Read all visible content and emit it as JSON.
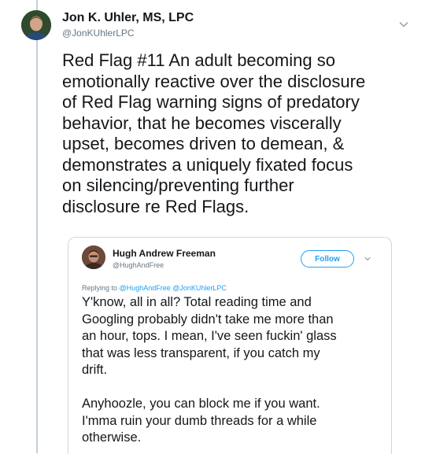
{
  "tweet": {
    "author_name": "Jon K. Uhler, MS, LPC",
    "author_handle": "@JonKUhlerLPC",
    "text_lines": [
      "Red Flag #11 An adult becoming so",
      "emotionally reactive over the disclosure",
      "of Red Flag warning signs of predatory",
      "behavior, that he becomes viscerally",
      "upset, becomes driven to demean, &",
      "demonstrates a uniquely fixated focus",
      "on silencing/preventing further",
      "disclosure re Red Flags."
    ]
  },
  "quoted_tweet": {
    "author_name": "Hugh Andrew Freeman",
    "author_handle": "@HughAndFree",
    "follow_label": "Follow",
    "replying_prefix": "Replying to",
    "replying_handles": [
      "@HughAndFree",
      "@JonKUhlerLPC"
    ],
    "paragraph1_lines": [
      "Y'know, all in all? Total reading time and",
      "Googling probably didn't take me more than",
      "an hour, tops. I mean, I've seen fuckin' glass",
      "that was less transparent, if you catch my",
      "drift."
    ],
    "paragraph2_lines": [
      "Anyhoozle, you can block me if you want.",
      "I'mma ruin your dumb threads for a while",
      "otherwise."
    ]
  },
  "icons": {
    "tweet_menu": "chevron-down-icon",
    "quoted_menu": "chevron-down-icon"
  },
  "colors": {
    "link": "#1da1f2",
    "secondary_text": "#657786",
    "thread_line": "#c4cfd6"
  }
}
